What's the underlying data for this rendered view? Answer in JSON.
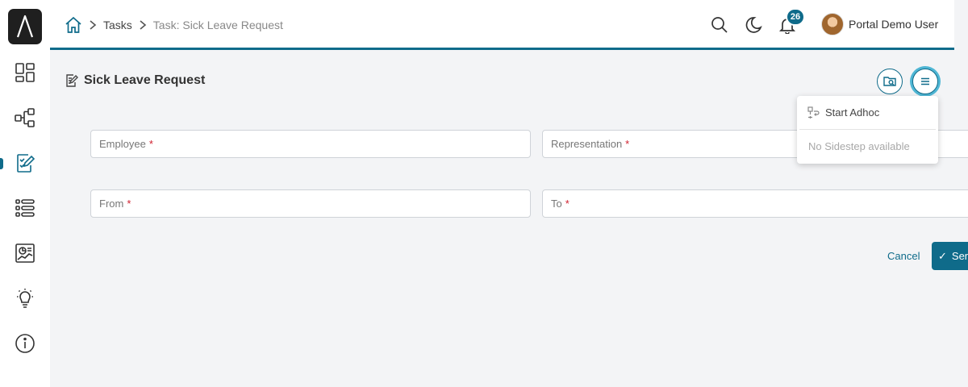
{
  "breadcrumb": {
    "tasks": "Tasks",
    "current": "Task: Sick Leave Request"
  },
  "header": {
    "notification_count": "26",
    "user_name": "Portal Demo User"
  },
  "page": {
    "title": "Sick Leave Request"
  },
  "dropdown": {
    "start_adhoc": "Start Adhoc",
    "no_sidestep": "No Sidestep available"
  },
  "form": {
    "employee_label": "Employee",
    "representation_label": "Representation",
    "from_label": "From",
    "to_label": "To",
    "required_mark": "*"
  },
  "actions": {
    "cancel_label": "Cancel",
    "send_label": "Send"
  },
  "colors": {
    "accent": "#0f6b8a",
    "required": "#d0202f"
  }
}
